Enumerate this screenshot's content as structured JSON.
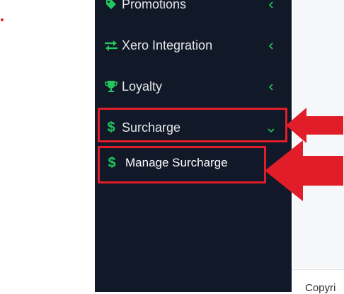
{
  "sidebar": {
    "items": [
      {
        "label": "Promotions",
        "icon": "tag-icon"
      },
      {
        "label": "Xero Integration",
        "icon": "arrows-exchange-icon"
      },
      {
        "label": "Loyalty",
        "icon": "trophy-icon"
      },
      {
        "label": "Surcharge",
        "icon": "dollar-icon"
      }
    ],
    "submenu": [
      {
        "label": "Manage Surcharge",
        "icon": "dollar-icon"
      }
    ]
  },
  "main": {
    "footer_text": "Copyri"
  },
  "colors": {
    "sidebar_bg": "#111827",
    "icon_green": "#22c55e",
    "annotation_red": "#e11d2a"
  }
}
